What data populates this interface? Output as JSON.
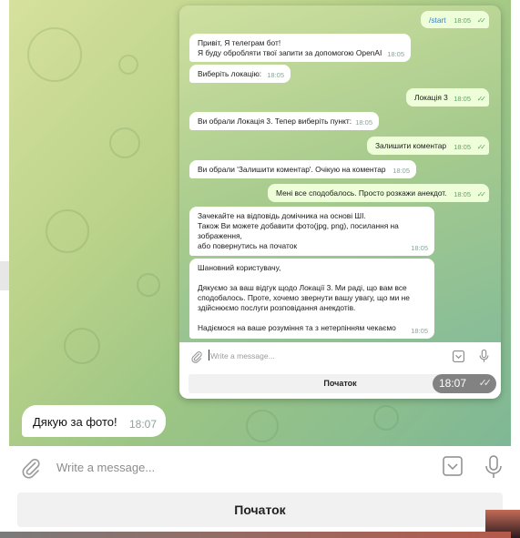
{
  "outer": {
    "message": {
      "text": "Дякую за фото!",
      "time": "18:07"
    },
    "input": {
      "placeholder": "Write a message..."
    },
    "keyboard_button": "Початок"
  },
  "inner": {
    "messages": [
      {
        "dir": "out",
        "lines": [
          "/start"
        ],
        "time": "18:05"
      },
      {
        "dir": "in",
        "lines": [
          "Привіт, Я телеграм бот!",
          "Я буду обробляти твої запити за допомогою OpenAI"
        ],
        "time": "18:05"
      },
      {
        "dir": "in",
        "lines": [
          "Виберіть локацію:"
        ],
        "time": "18:05"
      },
      {
        "dir": "out",
        "lines": [
          "Локація 3"
        ],
        "time": "18:05"
      },
      {
        "dir": "in",
        "lines": [
          "Ви обрали Локація 3. Тепер виберіть пункт:"
        ],
        "time": "18:05"
      },
      {
        "dir": "out",
        "lines": [
          "Залишити коментар"
        ],
        "time": "18:05"
      },
      {
        "dir": "in",
        "lines": [
          "Ви обрали 'Залишити коментар'. Очікую на коментар"
        ],
        "time": "18:05"
      },
      {
        "dir": "out",
        "lines": [
          "Мені все сподобалось. Просто розкажи анекдот."
        ],
        "time": "18:05"
      },
      {
        "dir": "in",
        "lines": [
          "Зачекайте на відповідь домічника на основі ШІ.",
          " Також Ви можете добавити фото(jpg, png), посилання на",
          "зображення,",
          "або повернутись на початок"
        ],
        "time": "18:05"
      },
      {
        "dir": "in",
        "lines": [
          "Шановний користувачу,",
          "",
          "Дякуємо за ваш відгук щодо Локації 3. Ми раді, що вам все",
          "сподобалось. Проте, хочемо звернути вашу увагу, що ми не",
          "здійснюємо послуги розповідання анекдотів.",
          "",
          "Надіємося на ваше розуміння та з нетерпінням чекаємо"
        ],
        "time": "18:05"
      }
    ],
    "input": {
      "placeholder": "Write a message..."
    },
    "keyboard_button": "Початок",
    "time_overlay": "18:07"
  },
  "icons": {
    "attach": "paperclip-icon",
    "emoji": "emoji-keyboard-icon",
    "mic": "microphone-icon",
    "read": "double-check-icon"
  },
  "colors": {
    "outgoing_bubble": "#eefed9",
    "incoming_bubble": "#ffffff",
    "read_check": "#5ea661",
    "wallpaper": "#a7cb8d"
  }
}
